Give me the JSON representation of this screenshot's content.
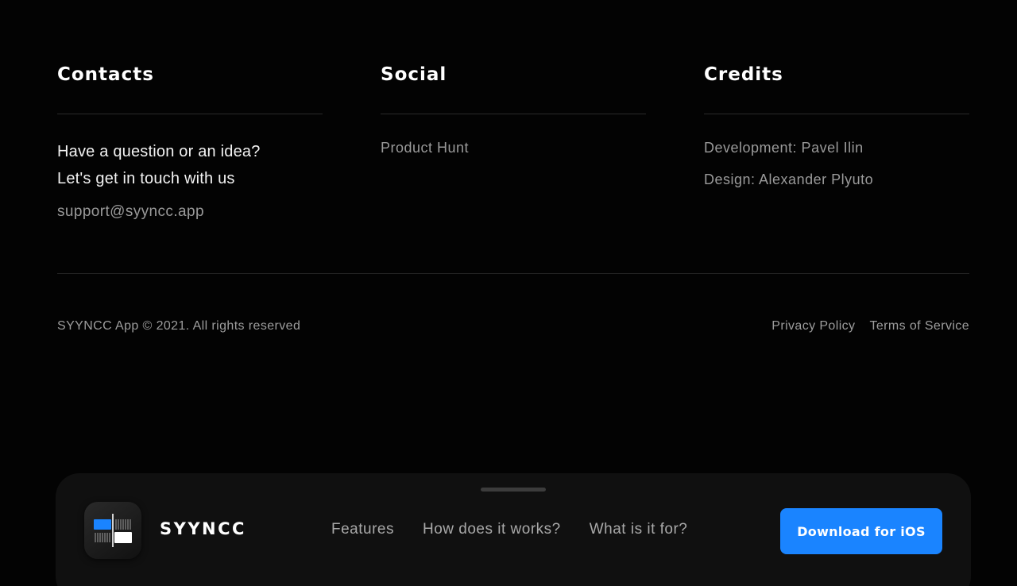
{
  "contacts": {
    "title": "Contacts",
    "question_line1": "Have a question or an idea?",
    "question_line2": "Let's get in touch with us",
    "email": "support@syyncc.app"
  },
  "social": {
    "title": "Social",
    "links": [
      "Product Hunt"
    ]
  },
  "credits": {
    "title": "Credits",
    "items": [
      "Development: Pavel Ilin",
      "Design: Alexander Plyuto"
    ]
  },
  "footer": {
    "copyright": "SYYNCC App © 2021. All rights reserved",
    "privacy": "Privacy Policy",
    "terms": "Terms of Service"
  },
  "navbar": {
    "logo_icon": "syyncc-app-icon",
    "brand": "SYYNCC",
    "links": [
      "Features",
      "How does it works?",
      "What is it for?"
    ],
    "cta": "Download for iOS"
  },
  "colors": {
    "background": "#030303",
    "navbar": "#101010",
    "accent": "#1a84ff",
    "muted_text": "#9a9a9a"
  }
}
